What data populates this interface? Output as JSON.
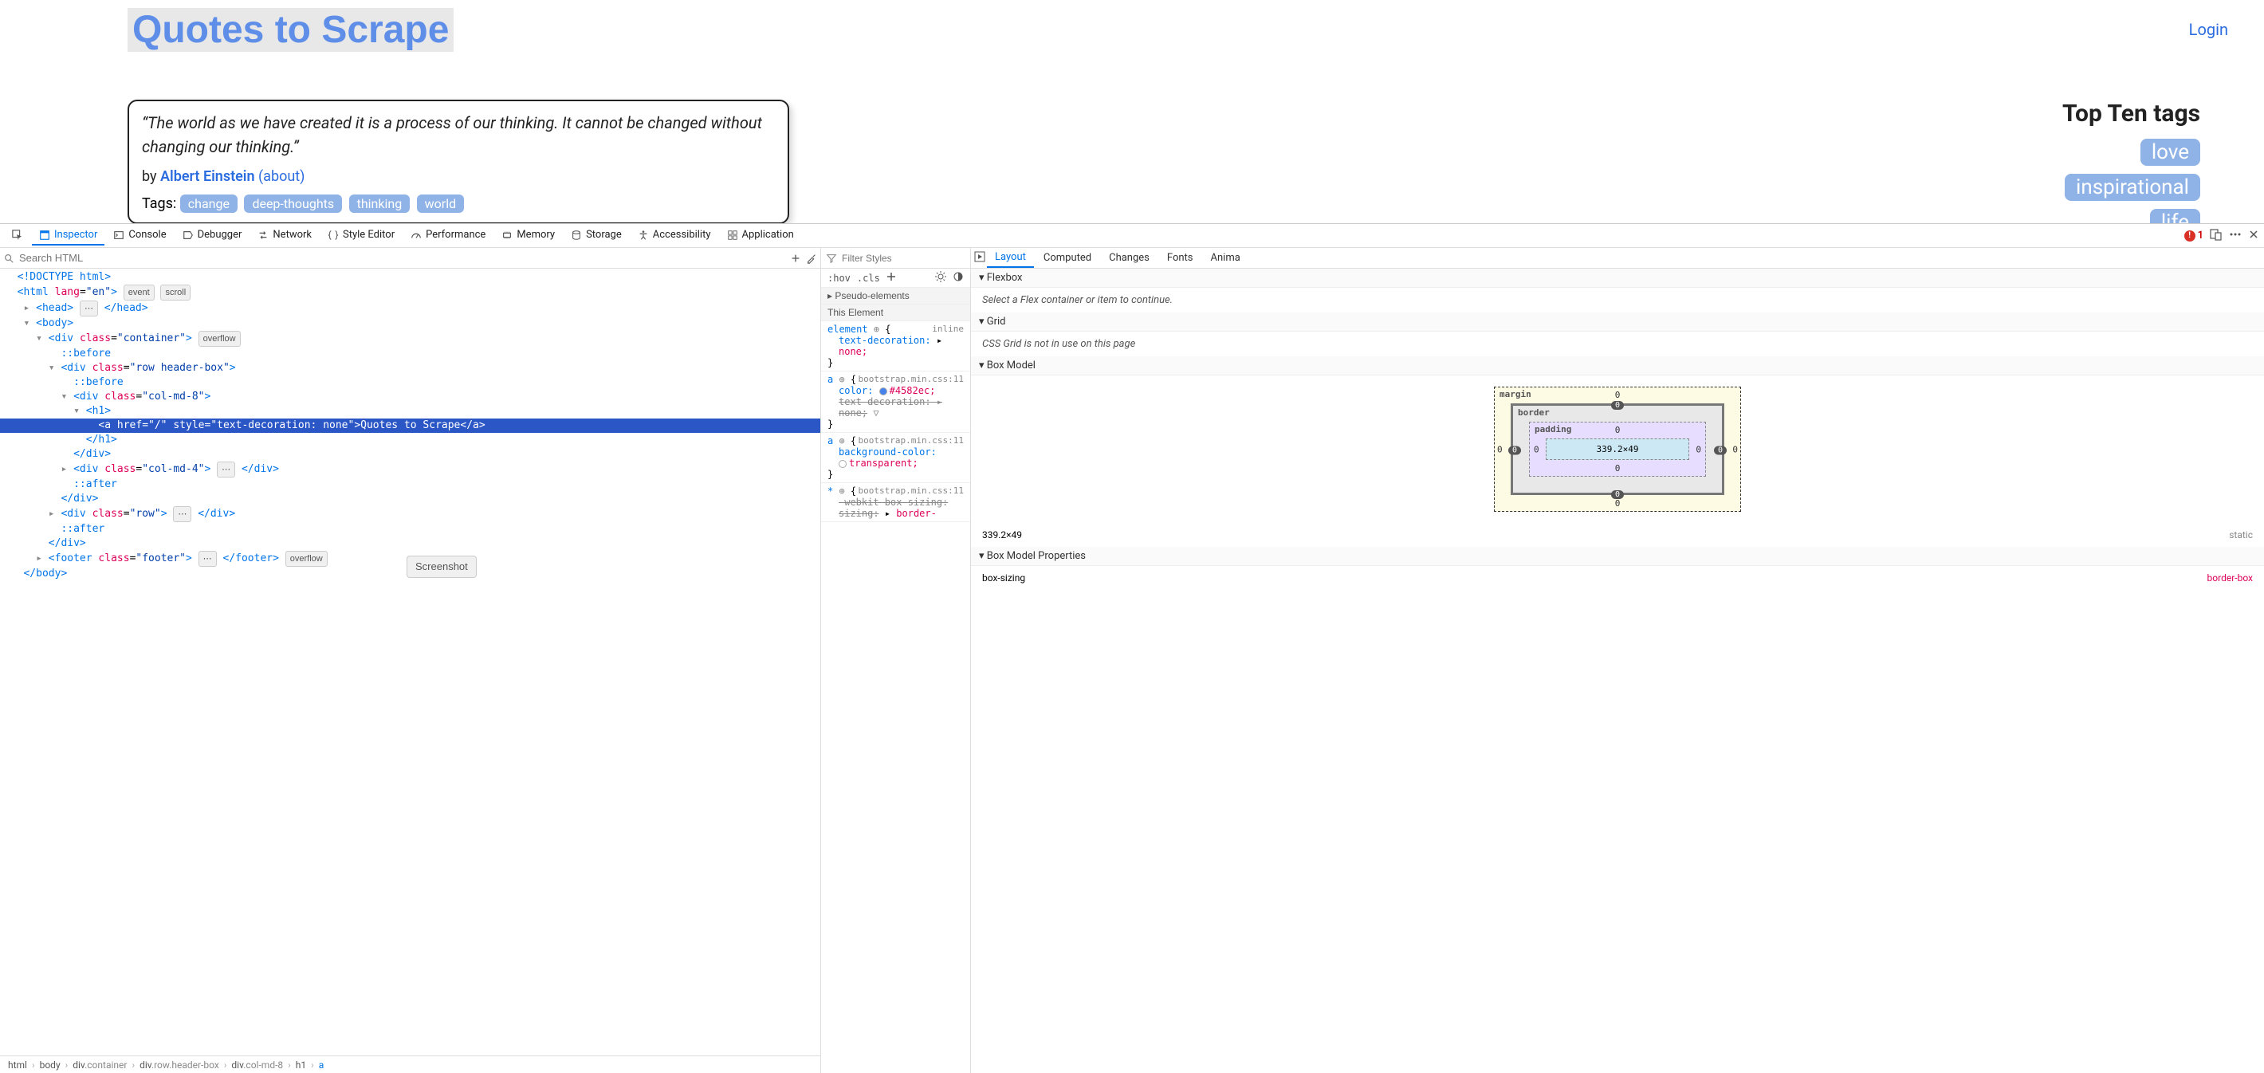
{
  "page": {
    "title": "Quotes to Scrape",
    "login": "Login",
    "quote": {
      "text": "“The world as we have created it is a process of our thinking. It cannot be changed without changing our thinking.”",
      "by_prefix": "by ",
      "author": "Albert Einstein",
      "about": "(about)",
      "tags_label": "Tags: ",
      "tags": [
        "change",
        "deep-thoughts",
        "thinking",
        "world"
      ]
    },
    "sidebar": {
      "title": "Top Ten tags",
      "tags": [
        "love",
        "inspirational",
        "life"
      ]
    }
  },
  "devtools": {
    "tabs": [
      "Inspector",
      "Console",
      "Debugger",
      "Network",
      "Style Editor",
      "Performance",
      "Memory",
      "Storage",
      "Accessibility",
      "Application"
    ],
    "active_tab": "Inspector",
    "error_count": "1",
    "search_placeholder": "Search HTML",
    "dom": {
      "doctype": "<!DOCTYPE html>",
      "html_open": "<html lang=\"en\">",
      "badges": [
        "event",
        "scroll"
      ],
      "head": "<head> … </head>",
      "body_open": "<body>",
      "container_open": "<div class=\"container\">",
      "container_badge": "overflow",
      "before1": "::before",
      "row_header_open": "<div class=\"row header-box\">",
      "before2": "::before",
      "col8_open": "<div class=\"col-md-8\">",
      "h1_open": "<h1>",
      "a_line": "<a href=\"/\" style=\"text-decoration: none\">Quotes to Scrape</a>",
      "h1_close": "</h1>",
      "div_close1": "</div>",
      "col4": "<div class=\"col-md-4\"> … </div>",
      "after1": "::after",
      "div_close2": "</div>",
      "row2": "<div class=\"row\"> … </div>",
      "after2": "::after",
      "div_close3": "</div>",
      "footer": "<footer class=\"footer\"> … </footer>",
      "footer_badge": "overflow",
      "body_close": "</body>",
      "tooltip": "Screenshot"
    },
    "breadcrumb": [
      "html",
      "body",
      "div.container",
      "div.row.header-box",
      "div.col-md-8",
      "h1",
      "a"
    ],
    "styles": {
      "filter_placeholder": "Filter Styles",
      "hov": ":hov",
      "cls": ".cls",
      "pseudo_header": "Pseudo-elements",
      "this_header": "This Element",
      "rules": [
        {
          "selector": "element",
          "source": "inline",
          "props": [
            {
              "n": "text-decoration:",
              "v": "none;",
              "arrow": true
            }
          ]
        },
        {
          "selector": "a",
          "source": "bootstrap.min.css:11",
          "props": [
            {
              "n": "color:",
              "v": "#4582ec;",
              "swatch": "#4582ec"
            },
            {
              "n": "text-decoration:",
              "v": "none;",
              "strike": true,
              "arrow": true,
              "filter": true
            }
          ]
        },
        {
          "selector": "a",
          "source": "bootstrap.min.css:11",
          "props": [
            {
              "n": "background-color:",
              "v": "transparent;",
              "swatch": "transparent"
            }
          ]
        },
        {
          "selector": "*",
          "source": "bootstrap.min.css:11",
          "props": [
            {
              "n": "-webkit-box-sizing:",
              "v": "border-",
              "strike": true
            }
          ]
        }
      ]
    },
    "layout_tabs": [
      "Layout",
      "Computed",
      "Changes",
      "Fonts",
      "Anima"
    ],
    "layout_active": "Layout",
    "flexbox": {
      "header": "Flexbox",
      "msg": "Select a Flex container or item to continue."
    },
    "grid": {
      "header": "Grid",
      "msg": "CSS Grid is not in use on this page"
    },
    "boxmodel": {
      "header": "Box Model",
      "margin_label": "margin",
      "border_label": "border",
      "padding_label": "padding",
      "content": "339.2×49",
      "margin": {
        "t": "0",
        "r": "0",
        "b": "0",
        "l": "0"
      },
      "border": {
        "t": "0",
        "r": "0",
        "b": "0",
        "l": "0"
      },
      "padding": {
        "t": "0",
        "r": "0",
        "b": "0",
        "l": "0"
      },
      "size_label": "339.2×49",
      "position": "static",
      "props_header": "Box Model Properties",
      "props": [
        {
          "n": "box-sizing",
          "v": "border-box"
        }
      ]
    }
  }
}
